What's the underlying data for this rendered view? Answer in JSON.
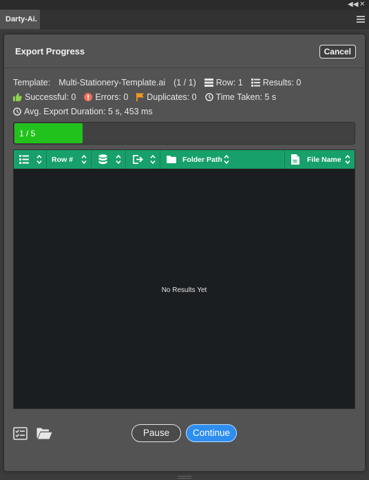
{
  "panel": {
    "tab_label": "Darty-Ai."
  },
  "dialog": {
    "title": "Export Progress",
    "cancel_label": "Cancel"
  },
  "stats": {
    "template_label": "Template:",
    "template_name": "Multi-Stationery-Template.ai",
    "template_count": "(1 / 1)",
    "row_label": "Row: 1",
    "results_label": "Results: 0",
    "successful_label": "Successful: 0",
    "errors_label": "Errors: 0",
    "duplicates_label": "Duplicates: 0",
    "time_taken_label": "Time Taken: 5 s",
    "avg_duration_label": "Avg. Export Duration: 5 s, 453 ms"
  },
  "progress": {
    "label": "1 / 5",
    "fraction": 0.2,
    "color": "#22c21c"
  },
  "table": {
    "columns": [
      {
        "icon": "list-icon",
        "label": ""
      },
      {
        "icon": "",
        "label": "Row #"
      },
      {
        "icon": "database-icon",
        "label": ""
      },
      {
        "icon": "export-icon",
        "label": ""
      },
      {
        "icon": "folder-icon",
        "label": "Folder Path"
      },
      {
        "icon": "file-icon",
        "label": "File Name"
      }
    ],
    "empty_text": "No Results Yet",
    "header_color": "#17a06a"
  },
  "footer": {
    "pause_label": "Pause",
    "continue_label": "Continue",
    "left_icons": [
      "checklist-icon",
      "open-folder-icon"
    ]
  },
  "colors": {
    "success": "#8fd14f",
    "error": "#ff6b5a",
    "duplicate": "#f39a1e",
    "primary": "#2d8ef0"
  }
}
